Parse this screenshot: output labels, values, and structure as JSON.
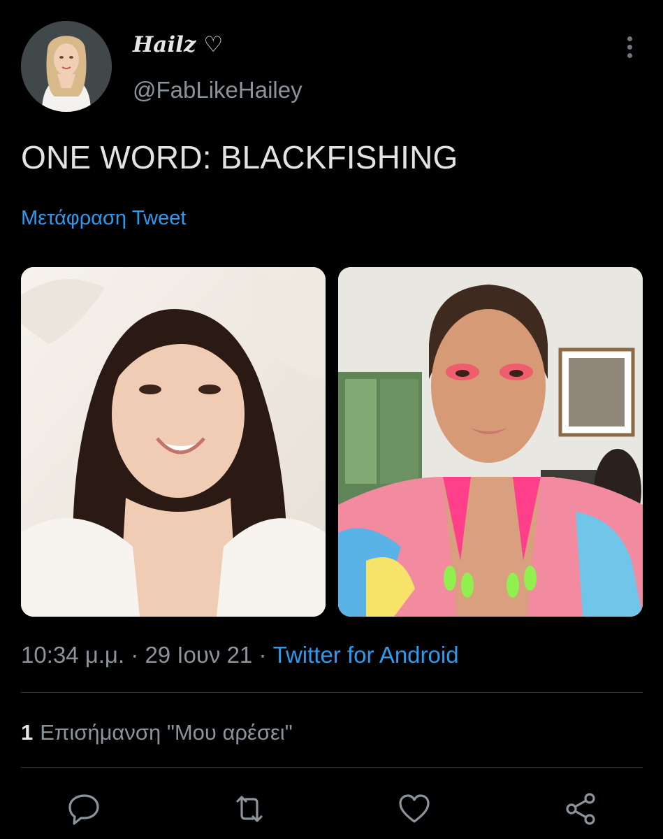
{
  "author": {
    "display_name": "Hailz ♡",
    "handle": "@FabLikeHailey",
    "avatar_icon": "profile-avatar"
  },
  "tweet": {
    "text": "ONE WORD: BLACKFISHING",
    "translate_label": "Μετάφραση Tweet",
    "photos": [
      "photo-smiling-portrait",
      "photo-glam-makeup-portrait"
    ]
  },
  "meta": {
    "time": "10:34 μ.μ.",
    "sep1": " · ",
    "date": "29 Ιουν 21",
    "sep2": " · ",
    "source": "Twitter for Android"
  },
  "engagement": {
    "likes_count": "1",
    "likes_label": "Επισήμανση \"Μου αρέσει\""
  },
  "actions": [
    "reply-icon",
    "retweet-icon",
    "like-icon",
    "share-icon"
  ],
  "colors": {
    "background": "#000000",
    "link": "#2b9bf0",
    "secondary_text": "#8b949b",
    "primary_text": "#e3e3e3",
    "icon": "#8b949b"
  }
}
